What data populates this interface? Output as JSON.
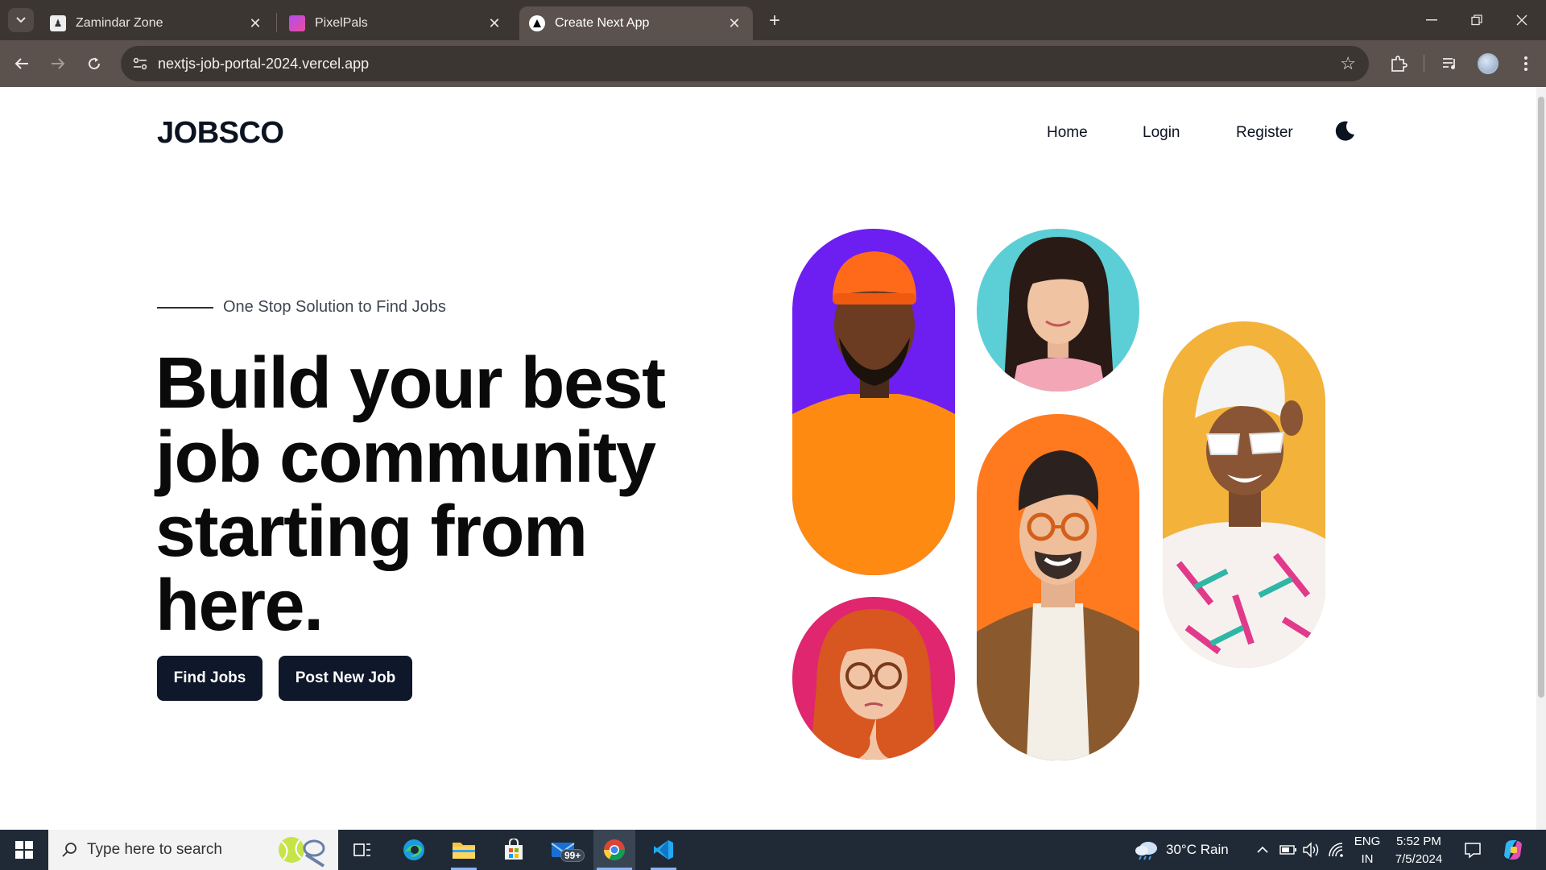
{
  "browser": {
    "tabs": [
      {
        "title": "Zamindar Zone",
        "icon": "zamindar-favicon"
      },
      {
        "title": "PixelPals",
        "icon": "pixelpals-favicon"
      },
      {
        "title": "Create Next App",
        "icon": "nextjs-favicon",
        "active": true
      }
    ],
    "url": "nextjs-job-portal-2024.vercel.app"
  },
  "site": {
    "logo": "JOBSCO",
    "nav": [
      "Home",
      "Login",
      "Register"
    ],
    "theme_icon": "moon-icon"
  },
  "hero": {
    "kicker": "One Stop Solution to Find Jobs",
    "headline": "Build your best job community starting from here.",
    "buttons": [
      "Find Jobs",
      "Post New Job"
    ]
  },
  "gallery": {
    "photos": [
      {
        "subject": "man-orange-beanie",
        "bg": "#6d1ef0"
      },
      {
        "subject": "woman-dark-hair",
        "bg": "#5ccfd6"
      },
      {
        "subject": "woman-white-sunglasses",
        "bg": "#f3b23a"
      },
      {
        "subject": "man-glasses-turtleneck",
        "bg": "#ff7a1f"
      },
      {
        "subject": "woman-red-hair-glasses",
        "bg": "#e0266e"
      }
    ]
  },
  "taskbar": {
    "search_placeholder": "Type here to search",
    "mail_badge": "99+",
    "weather": "30°C  Rain",
    "lang_top": "ENG",
    "lang_bottom": "IN",
    "time": "5:52 PM",
    "date": "7/5/2024"
  },
  "colors": {
    "primary": "#0f172a",
    "chrome_dark": "#3c3633",
    "chrome_toolbar": "#5b524d",
    "taskbar": "#1f2a36"
  }
}
